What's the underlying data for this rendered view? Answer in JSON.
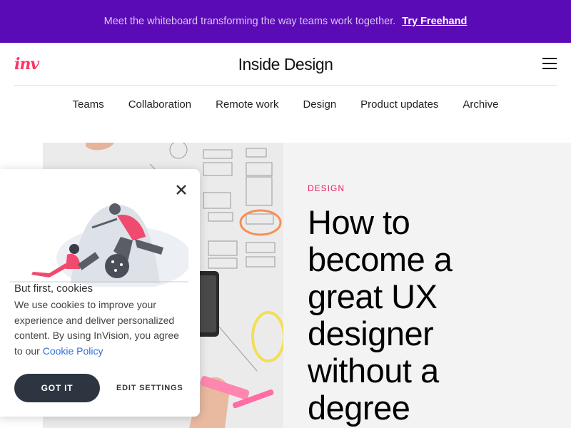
{
  "promo": {
    "text": "Meet the whiteboard transforming the way teams work together.",
    "link": "Try Freehand"
  },
  "header": {
    "logo": "inv",
    "title": "Inside Design"
  },
  "nav": {
    "items": [
      "Teams",
      "Collaboration",
      "Remote work",
      "Design",
      "Product updates",
      "Archive"
    ]
  },
  "article": {
    "category": "DESIGN",
    "headline_lines": [
      "How to",
      "become a",
      "great UX",
      "designer",
      "without a",
      "degree"
    ]
  },
  "cookie": {
    "title": "But first, cookies",
    "body": "We use cookies to improve your experience and deliver personalized content. By using InVision, you agree to our",
    "policy_link": "Cookie Policy",
    "accept_label": "GOT IT",
    "settings_label": "EDIT SETTINGS"
  },
  "colors": {
    "promo_bg": "#5b0bb5",
    "accent_pink": "#e3215b",
    "logo_pink": "#ff3366",
    "button_dark": "#2d3540",
    "link_blue": "#2f6fd6"
  }
}
